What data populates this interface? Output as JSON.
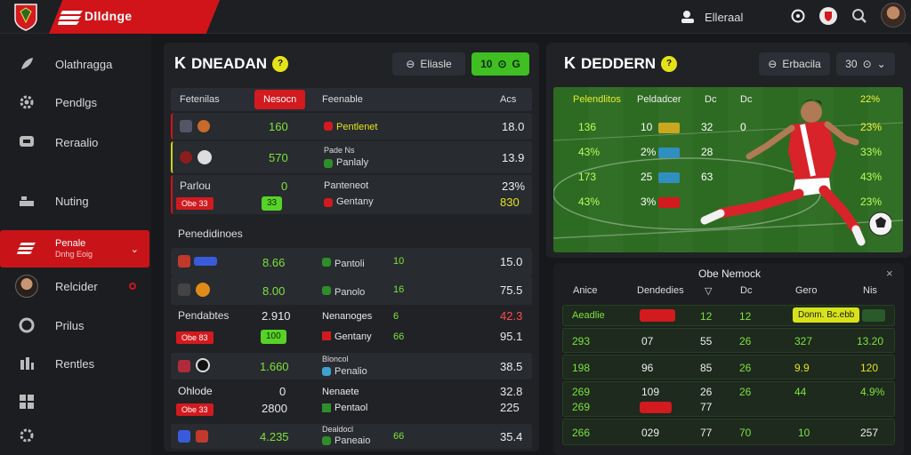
{
  "brand": {
    "title": "Dlldnge"
  },
  "header": {
    "user_label": "Elleraal"
  },
  "sidebar": {
    "items": [
      {
        "label": "Olathragga",
        "icon": "feather-icon"
      },
      {
        "label": "Pendlgs",
        "icon": "gear-icon"
      },
      {
        "label": "Reraalio",
        "icon": "chat-icon"
      },
      {
        "label": "Nuting",
        "icon": "stack-icon"
      },
      {
        "label": "Penale",
        "sub": "Dnhg Eoig",
        "icon": "flag-icon"
      },
      {
        "label": "Relcider",
        "icon": "avatar"
      },
      {
        "label": "Prilus",
        "icon": "clock-icon"
      },
      {
        "label": "Rentles",
        "icon": "bar-chart-icon"
      },
      {
        "label": "",
        "icon": "grid-icon"
      },
      {
        "label": "",
        "icon": "settings-icon"
      }
    ]
  },
  "left_panel": {
    "title": "DNEADAN",
    "badge": "?",
    "filter_label": "Eliasle",
    "toggle_label": "G",
    "toggle_prefix": "10",
    "columns": [
      "Fetenilas",
      "Nesocn",
      "Feenable",
      "Acs"
    ],
    "rows": [
      {
        "team1": "",
        "score": "160",
        "team2": "Pentlenet",
        "value": "18.0"
      },
      {
        "team1": "",
        "score": "570",
        "team2": "Pade Ns",
        "team2b": "Panlaly",
        "value": "13.9"
      },
      {
        "team1": "Parlou",
        "score": "0",
        "team2": "Panteneot",
        "team2b": "Gentany",
        "value": "23%",
        "value2": "830",
        "chip": "Obe 33",
        "gchip": "33"
      }
    ],
    "section": "Penedidinoes",
    "rows2": [
      {
        "a": "8.66",
        "b": "Pantoli",
        "c": "10",
        "v": "15.0"
      },
      {
        "a": "8.00",
        "b": "Panolo",
        "c": "16",
        "v": "75.5"
      },
      {
        "label": "Pendabtes",
        "a": "2.910",
        "chip": "Obe 83",
        "gchip": "100",
        "b": "Nenanoges",
        "b2": "Gentany",
        "c": "6",
        "c2": "66",
        "v": "42.3",
        "v2": "95.1"
      },
      {
        "a": "1.660",
        "b": "Bloncol",
        "b2": "Penalio",
        "v": "38.5"
      },
      {
        "label": "Ohlode",
        "a": "0",
        "a2": "2800",
        "chip": "Obe 33",
        "b": "Nenaete",
        "b2": "Pentaol",
        "v": "32.8",
        "v2": "225"
      },
      {
        "a": "4.235",
        "b": "Dealdocl",
        "b2": "Paneaio",
        "c": "66",
        "v": "35.4"
      }
    ]
  },
  "right_panel": {
    "title": "DEDDERN",
    "badge": "?",
    "filter_label": "Erbacila",
    "dropdown_label": "30",
    "pitch_headers": [
      "Pelendlitos",
      "Peldadcer",
      "Dc",
      "Dc",
      "22%"
    ],
    "pitch_rows": [
      {
        "a": "136",
        "b": "10",
        "c": "32",
        "d": "0",
        "e": "23%"
      },
      {
        "a": "43%",
        "b": "2%",
        "c": "28",
        "d": "",
        "e": "33%"
      },
      {
        "a": "173",
        "b": "25",
        "c": "63",
        "d": "",
        "e": "43%"
      },
      {
        "a": "43%",
        "b": "3%",
        "c": "",
        "d": "",
        "e": "23%"
      }
    ]
  },
  "right_table": {
    "title": "Obe Nemock",
    "columns": [
      "Anice",
      "Dendedies",
      "Dc",
      "Gero",
      "Nis"
    ],
    "highlight": {
      "a": "Aeadlie",
      "chip": "Donm. Bc.ebb",
      "b": "12",
      "c": "12"
    },
    "rows": [
      {
        "a": "293",
        "b": "07",
        "c": "55",
        "d": "26",
        "e": "327",
        "f": "13.20"
      },
      {
        "a": "198",
        "b": "96",
        "c": "85",
        "d": "26",
        "e": "9.9",
        "f": "120"
      },
      {
        "a": "269",
        "b": "109",
        "c": "26",
        "d": "26",
        "e": "44",
        "f": "4.9%"
      },
      {
        "a": "266",
        "b": "029",
        "c": "77",
        "d": "70",
        "e": "10",
        "f": "257"
      }
    ]
  },
  "colors": {
    "brand_red": "#d0141a",
    "accent_green": "#3fbf22",
    "accent_yellow": "#e3e31b"
  }
}
